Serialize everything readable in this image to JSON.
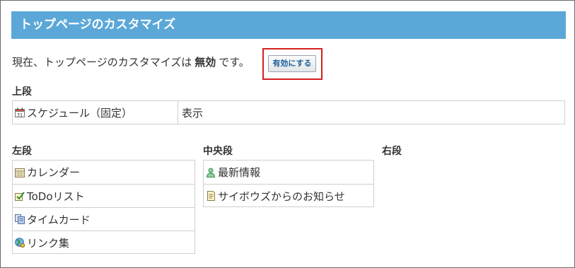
{
  "header": {
    "title": "トップページのカスタマイズ"
  },
  "status": {
    "prefix": "現在、トップページのカスタマイズは",
    "state": "無効",
    "suffix": "です。",
    "enable_button_label": "有効にする"
  },
  "top_section": {
    "heading": "上段",
    "rows": [
      {
        "label": "スケジュール（固定）",
        "icon": "calendar-icon",
        "value": "表示"
      }
    ]
  },
  "left_section": {
    "heading": "左段",
    "items": [
      {
        "label": "カレンダー",
        "icon": "calendar-grid-icon"
      },
      {
        "label": "ToDoリスト",
        "icon": "todo-check-icon"
      },
      {
        "label": "タイムカード",
        "icon": "timecard-icon"
      },
      {
        "label": "リンク集",
        "icon": "globe-link-icon"
      }
    ]
  },
  "center_section": {
    "heading": "中央段",
    "items": [
      {
        "label": "最新情報",
        "icon": "person-icon"
      },
      {
        "label": "サイボウズからのお知らせ",
        "icon": "notice-document-icon"
      }
    ]
  },
  "right_section": {
    "heading": "右段"
  },
  "colors": {
    "title_bar": "#5ba8d8",
    "highlight_border": "#d62020",
    "button_text": "#1f5f9b"
  }
}
